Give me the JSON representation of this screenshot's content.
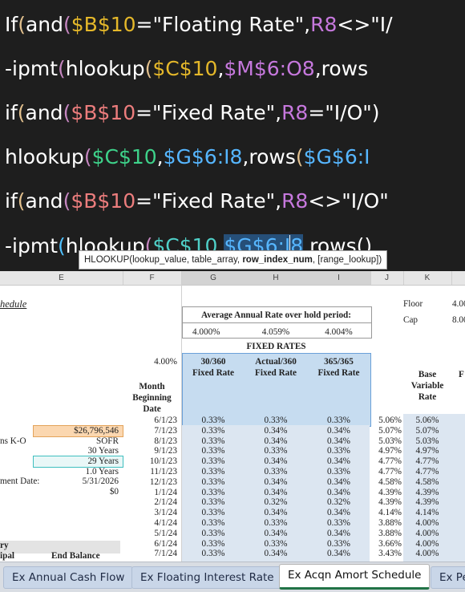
{
  "formula": {
    "line1": {
      "f1": "If",
      "b1": "(",
      "f2": "and",
      "b2": "(",
      "ref1": "$B$10",
      "txt1": "=\"Floating Rate\",",
      "ref2": "R8",
      "txt2": "<>\"I/"
    },
    "line2": {
      "f1": "-ipmt",
      "b1": "(",
      "f2": "hlookup",
      "b2": "(",
      "ref1": "$C$10",
      "txt1": ",",
      "ref2": "$M$6:O8",
      "txt2": ",rows"
    },
    "line3": {
      "f1": "if",
      "b1": "(",
      "f2": "and",
      "b2": "(",
      "ref1": "$B$10",
      "txt1": "=\"Fixed Rate\",",
      "ref2": "R8",
      "txt2": "=\"I/O\")"
    },
    "line4": {
      "f1": "hlookup",
      "b1": "(",
      "ref1": "$C$10",
      "txt1": ",",
      "ref2": "$G$6:I8",
      "txt2": ",rows",
      "b2": "(",
      "ref3": "$G$6:I"
    },
    "line5": {
      "f1": "if",
      "b1": "(",
      "f2": "and",
      "b2": "(",
      "ref1": "$B$10",
      "txt1": "=\"Fixed Rate\",",
      "ref2": "R8",
      "txt2": "<>\"I/O\""
    },
    "line6": {
      "f1": "-ipmt",
      "b1": "(",
      "f2": "hlookup",
      "b2": "(",
      "ref1": "$C$10",
      "txt1": ",",
      "sel_a": "$G$6:I",
      "sel_b": "8",
      "txt2": ",rows()"
    }
  },
  "tooltip": {
    "part1": "HLOOKUP(lookup_value, table_array, ",
    "bold": "row_index_num",
    "part2": ", [range_lookup])"
  },
  "column_headers": [
    "E",
    "F",
    "G",
    "H",
    "I",
    "J",
    "K"
  ],
  "sheet": {
    "schedule_fragment": "hedule",
    "floor_label": "Floor",
    "floor_value": "4.00",
    "cap_label": "Cap",
    "cap_value": "8.00",
    "avg_title": "Average Annual Rate over hold period:",
    "avg_g": "4.000%",
    "avg_h": "4.059%",
    "avg_i": "4.004%",
    "fixed_rates_title": "FIXED RATES",
    "f_rate": "4.00%",
    "g_head1": "30/360",
    "g_head2": "Fixed Rate",
    "h_head1": "Actual/360",
    "h_head2": "Fixed Rate",
    "i_head1": "365/365",
    "i_head2": "Fixed Rate",
    "month_head": [
      "Month",
      "Beginning",
      "Date"
    ],
    "base_head": [
      "Base",
      "Variable",
      "Rate"
    ],
    "l_head_fragment": "F",
    "left_labels": {
      "amount": "$26,796,546",
      "ko_label": "ns K-O",
      "ko_value": "SOFR",
      "years1": "30 Years",
      "years2": "29 Years",
      "years3": "1.0 Years",
      "pay_label": "ment Date:",
      "pay_value": "5/31/2026",
      "zero": "$0",
      "ry": "ry",
      "ipal": "ipal",
      "end_balance": "End Balance"
    },
    "rows": [
      {
        "date": "6/1/23",
        "g": "0.33%",
        "h": "0.33%",
        "i": "0.33%",
        "j": "5.06%",
        "k": "5.06%"
      },
      {
        "date": "7/1/23",
        "g": "0.33%",
        "h": "0.34%",
        "i": "0.34%",
        "j": "5.07%",
        "k": "5.07%"
      },
      {
        "date": "8/1/23",
        "g": "0.33%",
        "h": "0.34%",
        "i": "0.34%",
        "j": "5.03%",
        "k": "5.03%"
      },
      {
        "date": "9/1/23",
        "g": "0.33%",
        "h": "0.33%",
        "i": "0.33%",
        "j": "4.97%",
        "k": "4.97%"
      },
      {
        "date": "10/1/23",
        "g": "0.33%",
        "h": "0.34%",
        "i": "0.34%",
        "j": "4.77%",
        "k": "4.77%"
      },
      {
        "date": "11/1/23",
        "g": "0.33%",
        "h": "0.33%",
        "i": "0.33%",
        "j": "4.77%",
        "k": "4.77%"
      },
      {
        "date": "12/1/23",
        "g": "0.33%",
        "h": "0.34%",
        "i": "0.34%",
        "j": "4.58%",
        "k": "4.58%"
      },
      {
        "date": "1/1/24",
        "g": "0.33%",
        "h": "0.34%",
        "i": "0.34%",
        "j": "4.39%",
        "k": "4.39%"
      },
      {
        "date": "2/1/24",
        "g": "0.33%",
        "h": "0.32%",
        "i": "0.32%",
        "j": "4.39%",
        "k": "4.39%"
      },
      {
        "date": "3/1/24",
        "g": "0.33%",
        "h": "0.34%",
        "i": "0.34%",
        "j": "4.14%",
        "k": "4.14%"
      },
      {
        "date": "4/1/24",
        "g": "0.33%",
        "h": "0.33%",
        "i": "0.33%",
        "j": "3.88%",
        "k": "4.00%"
      },
      {
        "date": "5/1/24",
        "g": "0.33%",
        "h": "0.34%",
        "i": "0.34%",
        "j": "3.88%",
        "k": "4.00%"
      },
      {
        "date": "6/1/24",
        "g": "0.33%",
        "h": "0.33%",
        "i": "0.33%",
        "j": "3.66%",
        "k": "4.00%"
      },
      {
        "date": "7/1/24",
        "g": "0.33%",
        "h": "0.34%",
        "i": "0.34%",
        "j": "3.43%",
        "k": "4.00%"
      }
    ]
  },
  "tabs": [
    "Ex Annual Cash Flow",
    "Ex Floating Interest Rate",
    "Ex Acqn Amort Schedule",
    "Ex Pe"
  ],
  "active_tab": "Ex Acqn Amort Schedule",
  "colors": {
    "editor_bg": "#1e1e1e",
    "selection_fill": "#c6dcf0",
    "active_tab_accent": "#217346"
  }
}
